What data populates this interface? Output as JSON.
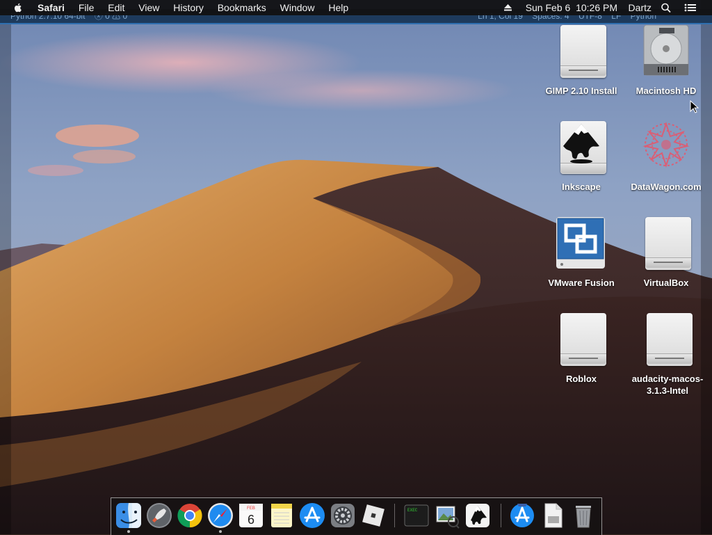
{
  "menubar": {
    "apple_icon": "apple-logo-icon",
    "app_name": "Safari",
    "menus": [
      "File",
      "Edit",
      "View",
      "History",
      "Bookmarks",
      "Window",
      "Help"
    ],
    "eject_icon": "eject-icon",
    "datetime": "Sun Feb 6  10:26 PM",
    "user": "Dartz",
    "search_icon": "spotlight-search-icon",
    "notifications_icon": "notification-center-icon"
  },
  "editor_status": {
    "python": "Python 2.7.10 64-bit",
    "problems": "ⓧ 0 ⚠ 0",
    "position": "Ln 1, Col 19",
    "spaces": "Spaces: 4",
    "encoding": "UTF-8",
    "eol": "LF",
    "language": "Python"
  },
  "desktop": {
    "icons": [
      {
        "label": "GIMP 2.10 Install",
        "icon": "external-drive-icon"
      },
      {
        "label": "Macintosh HD",
        "icon": "internal-hard-disk-icon"
      },
      {
        "label": "Inkscape",
        "icon": "inkscape-disk-icon"
      },
      {
        "label": "DataWagon.com",
        "icon": "datawagon-logo-icon"
      },
      {
        "label": "VMware Fusion",
        "icon": "vmware-fusion-icon"
      },
      {
        "label": "VirtualBox",
        "icon": "external-drive-icon"
      },
      {
        "label": "Roblox",
        "icon": "external-drive-icon"
      },
      {
        "label": "audacity-macos-3.1.3-Intel",
        "icon": "external-drive-icon"
      }
    ]
  },
  "dock": {
    "items": [
      {
        "name": "finder-icon",
        "running": true
      },
      {
        "name": "launchpad-icon",
        "running": false
      },
      {
        "name": "chrome-icon",
        "running": false
      },
      {
        "name": "safari-icon",
        "running": true
      },
      {
        "name": "calendar-icon",
        "running": false,
        "month": "FEB",
        "day": "6"
      },
      {
        "name": "notes-icon",
        "running": false
      },
      {
        "name": "app-store-icon",
        "running": false
      },
      {
        "name": "system-preferences-icon",
        "running": false
      },
      {
        "name": "roblox-icon",
        "running": false
      },
      {
        "name": "terminal-icon",
        "running": false,
        "text": "EXEC"
      },
      {
        "name": "preview-icon",
        "running": false
      },
      {
        "name": "inkscape-icon",
        "running": false
      },
      {
        "name": "downloads-folder-icon",
        "running": false
      },
      {
        "name": "document-stack-icon",
        "running": false
      },
      {
        "name": "trash-icon",
        "running": false
      }
    ]
  }
}
